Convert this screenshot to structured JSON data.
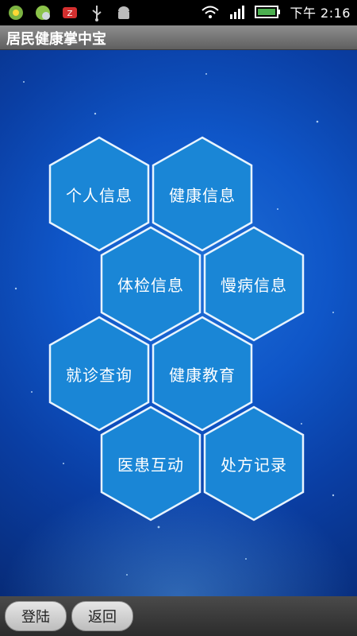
{
  "status_bar": {
    "time": "下午 2:16",
    "left_icons": [
      "app-icon-1",
      "app-icon-2",
      "zip-icon",
      "usb-icon",
      "android-icon"
    ],
    "right_icons": [
      "wifi-icon",
      "signal-icon",
      "battery-icon"
    ]
  },
  "app": {
    "title": "居民健康掌中宝"
  },
  "menu": {
    "items": [
      {
        "label": "个人信息"
      },
      {
        "label": "健康信息"
      },
      {
        "label": "体检信息"
      },
      {
        "label": "慢病信息"
      },
      {
        "label": "就诊查询"
      },
      {
        "label": "健康教育"
      },
      {
        "label": "医患互动"
      },
      {
        "label": "处方记录"
      }
    ]
  },
  "bottom": {
    "login_label": "登陆",
    "back_label": "返回"
  },
  "colors": {
    "hex_fill": "#1a86d6",
    "hex_stroke": "#e8f4ff",
    "background": "#0f56c8"
  }
}
